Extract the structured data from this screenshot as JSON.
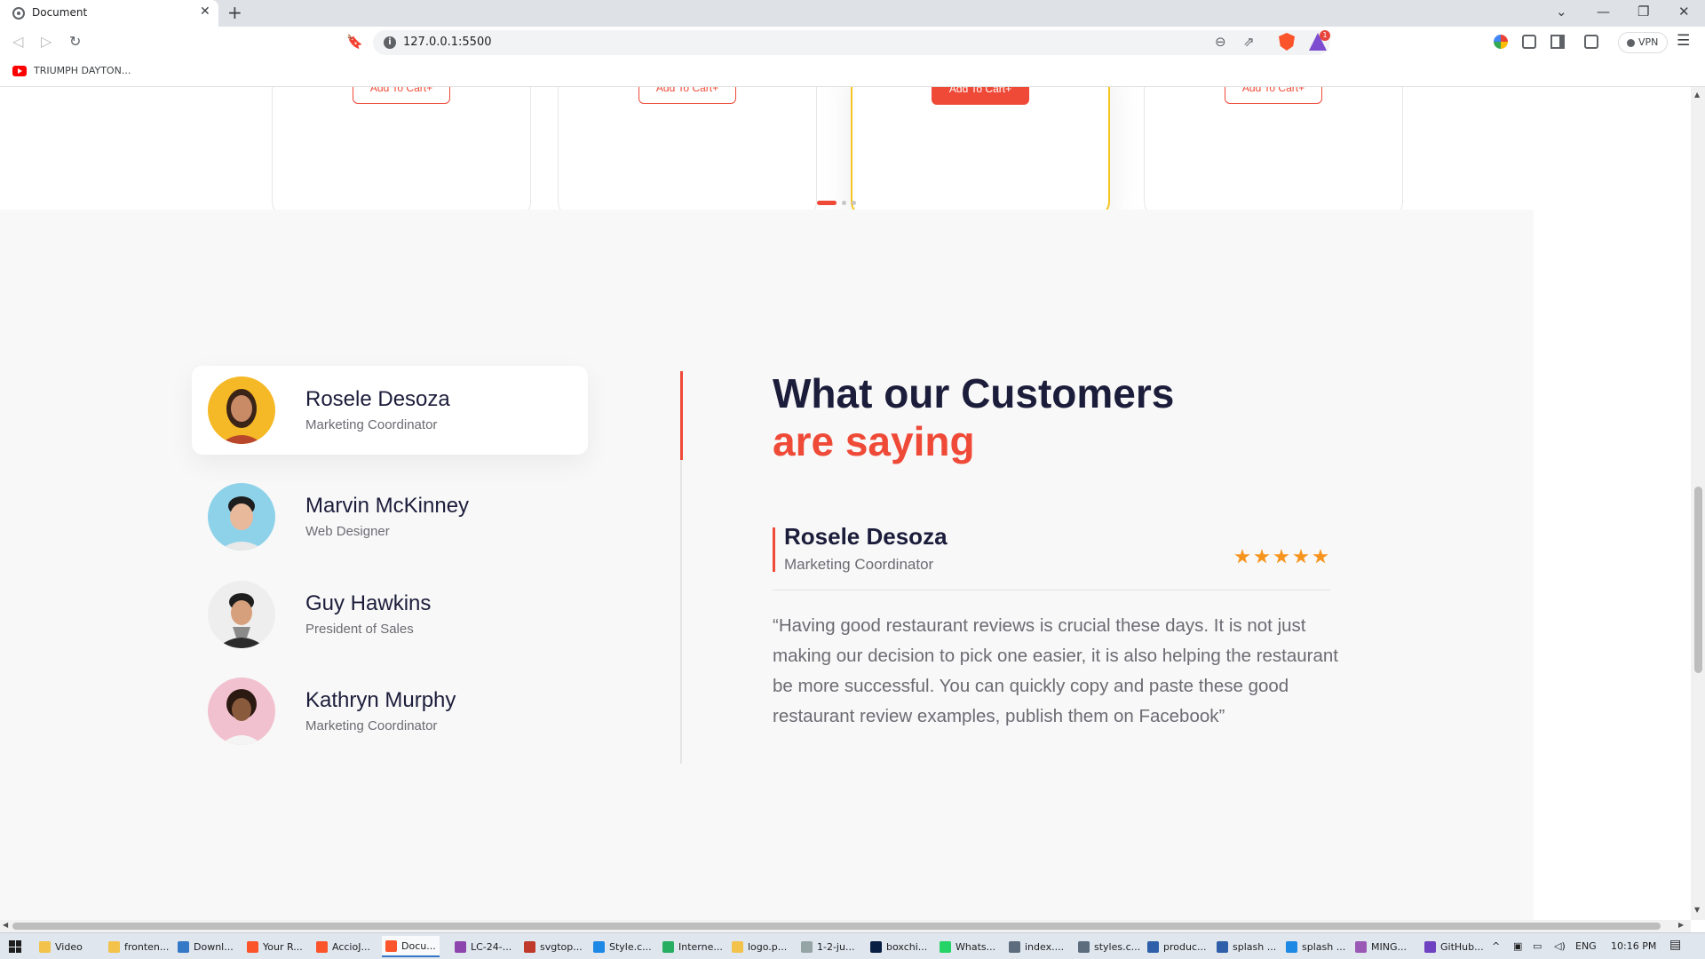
{
  "browser": {
    "tab_title": "Document",
    "tab_close": "✕",
    "new_tab": "+",
    "url": "127.0.0.1:5500",
    "vpn_label": "VPN",
    "rewards_count": "1",
    "bookmark": "TRIUMPH DAYTON...",
    "window_controls": [
      "⌄",
      "—",
      "❐",
      "✕"
    ]
  },
  "products": {
    "cards": [
      {
        "button": "Add To Cart+",
        "active": false
      },
      {
        "button": "Add To Cart+",
        "active": false
      },
      {
        "button": "Add To Cart+",
        "active": true
      },
      {
        "button": "Add To Cart+",
        "active": false
      }
    ],
    "carousel_dots": 3,
    "active_dot": 0
  },
  "testimonials": {
    "heading_line1": "What our Customers",
    "heading_line2": "are saying",
    "people": [
      {
        "name": "Rosele Desoza",
        "role": "Marketing Coordinator",
        "active": true
      },
      {
        "name": "Marvin McKinney",
        "role": "Web Designer",
        "active": false
      },
      {
        "name": "Guy Hawkins",
        "role": "President of Sales",
        "active": false
      },
      {
        "name": "Kathryn Murphy",
        "role": "Marketing Coordinator",
        "active": false
      }
    ],
    "selected": {
      "name": "Rosele Desoza",
      "role": "Marketing Coordinator",
      "rating": 5,
      "quote": "“Having good restaurant reviews is crucial these days. It is not just making our decision to pick one easier, it is also helping the restaurant be more successful. You can quickly copy and paste these good restaurant review examples, publish them on Facebook”"
    }
  },
  "colors": {
    "accent": "#ef4a37",
    "highlight": "#f6c523",
    "star": "#f7941d",
    "navy": "#1c1d3b"
  },
  "taskbar": {
    "items": [
      {
        "label": "Video",
        "color": "#f2c24b"
      },
      {
        "label": "fronten...",
        "color": "#f2c24b"
      },
      {
        "label": "Downl...",
        "color": "#3478c6"
      },
      {
        "label": "Your R...",
        "color": "#fb542b"
      },
      {
        "label": "AccioJ...",
        "color": "#fb542b"
      },
      {
        "label": "Docu...",
        "color": "#fb542b",
        "active": true
      },
      {
        "label": "LC-24-...",
        "color": "#8e44ad"
      },
      {
        "label": "svgtop...",
        "color": "#c0392b"
      },
      {
        "label": "Style.c...",
        "color": "#1e88e5"
      },
      {
        "label": "Interne...",
        "color": "#27ae60"
      },
      {
        "label": "logo.p...",
        "color": "#f2c24b"
      },
      {
        "label": "1-2-ju...",
        "color": "#95a5a6"
      },
      {
        "label": "boxchi...",
        "color": "#0a1f44"
      },
      {
        "label": "Whats...",
        "color": "#25d366"
      },
      {
        "label": "index....",
        "color": "#5d6d7e"
      },
      {
        "label": "styles.c...",
        "color": "#5d6d7e"
      },
      {
        "label": "produc...",
        "color": "#2e5fa8"
      },
      {
        "label": "splash ...",
        "color": "#2e5fa8"
      },
      {
        "label": "splash ...",
        "color": "#1e88e5"
      },
      {
        "label": "MING...",
        "color": "#9b59b6"
      },
      {
        "label": "GitHub...",
        "color": "#6f42c1"
      }
    ],
    "language": "ENG",
    "time": "10:16 PM"
  }
}
